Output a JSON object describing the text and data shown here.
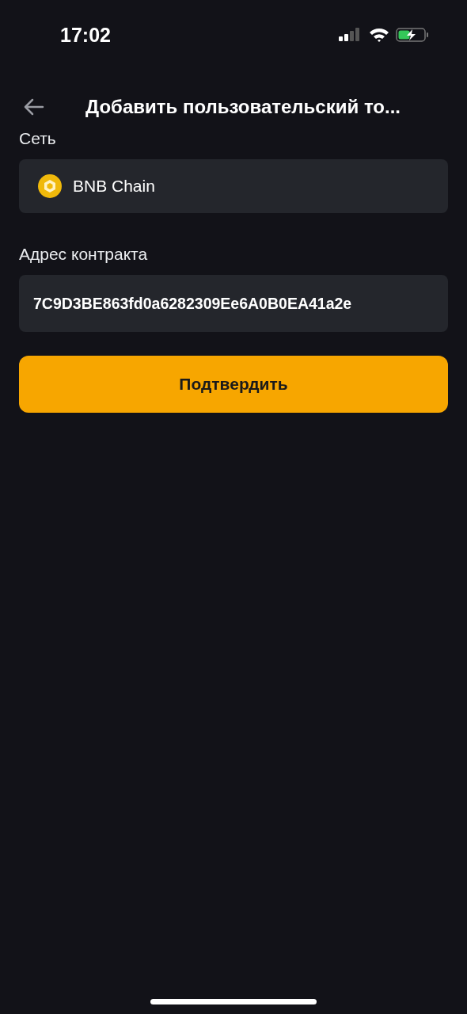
{
  "status_bar": {
    "time": "17:02"
  },
  "header": {
    "title": "Добавить пользовательский то..."
  },
  "network": {
    "label": "Сеть",
    "value": "BNB Chain"
  },
  "contract": {
    "label": "Адрес контракта",
    "value": "7C9D3BE863fd0a6282309Ee6A0B0EA41a2e"
  },
  "confirm_button": {
    "label": "Подтвердить"
  }
}
